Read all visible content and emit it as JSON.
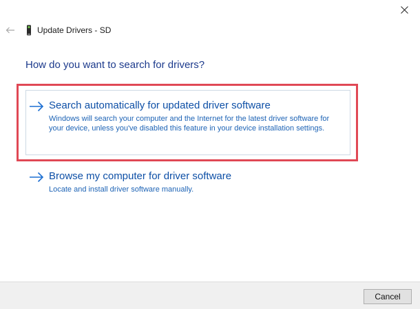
{
  "window": {
    "title": "Update Drivers - SD",
    "close_icon": "close-icon",
    "back_icon": "back-arrow-icon",
    "device_icon": "sd-card-icon"
  },
  "heading": "How do you want to search for drivers?",
  "options": [
    {
      "title": "Search automatically for updated driver software",
      "description": "Windows will search your computer and the Internet for the latest driver software for your device, unless you've disabled this feature in your device installation settings.",
      "icon": "arrow-right-icon",
      "highlighted": true
    },
    {
      "title": "Browse my computer for driver software",
      "description": "Locate and install driver software manually.",
      "icon": "arrow-right-icon",
      "highlighted": false
    }
  ],
  "footer": {
    "cancel_label": "Cancel"
  },
  "colors": {
    "heading": "#1c3a8c",
    "link": "#0d4fa6",
    "description": "#1d63b5",
    "highlight_border": "#e04855",
    "footer_bg": "#f0f0f0"
  }
}
